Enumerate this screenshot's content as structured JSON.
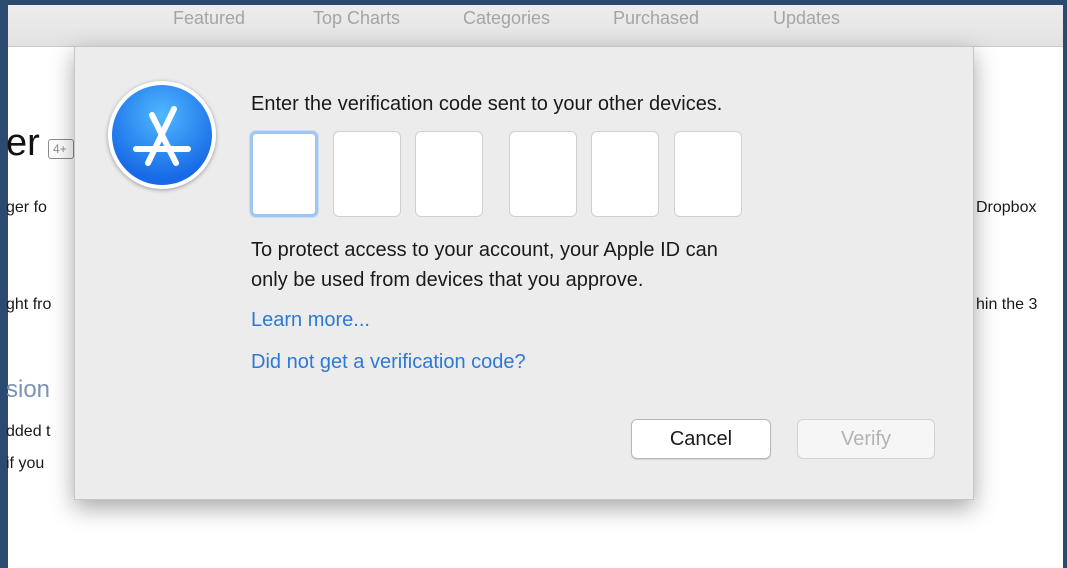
{
  "toolbar": {
    "tabs": [
      "Featured",
      "Top Charts",
      "Categories",
      "Purchased",
      "Updates"
    ]
  },
  "background": {
    "title_fragment": "er",
    "age_badge": "4+",
    "line1": "ger fo",
    "line2": "ght fro",
    "section_fragment": "sion",
    "line3": "dded t",
    "line4": "if you",
    "right1": "Dropbox",
    "right2": "hin the 3"
  },
  "dialog": {
    "icon": "app-store-icon",
    "prompt": "Enter the verification code sent to your other devices.",
    "code_digits": [
      "",
      "",
      "",
      "",
      "",
      ""
    ],
    "info_line1": "To protect access to your account, your Apple ID can",
    "info_line2": "only be used from devices that you approve.",
    "learn_more": "Learn more...",
    "no_code": "Did not get a verification code?",
    "cancel_label": "Cancel",
    "verify_label": "Verify",
    "link_color": "#2c79d6",
    "focus_color": "#9fc6f2"
  }
}
